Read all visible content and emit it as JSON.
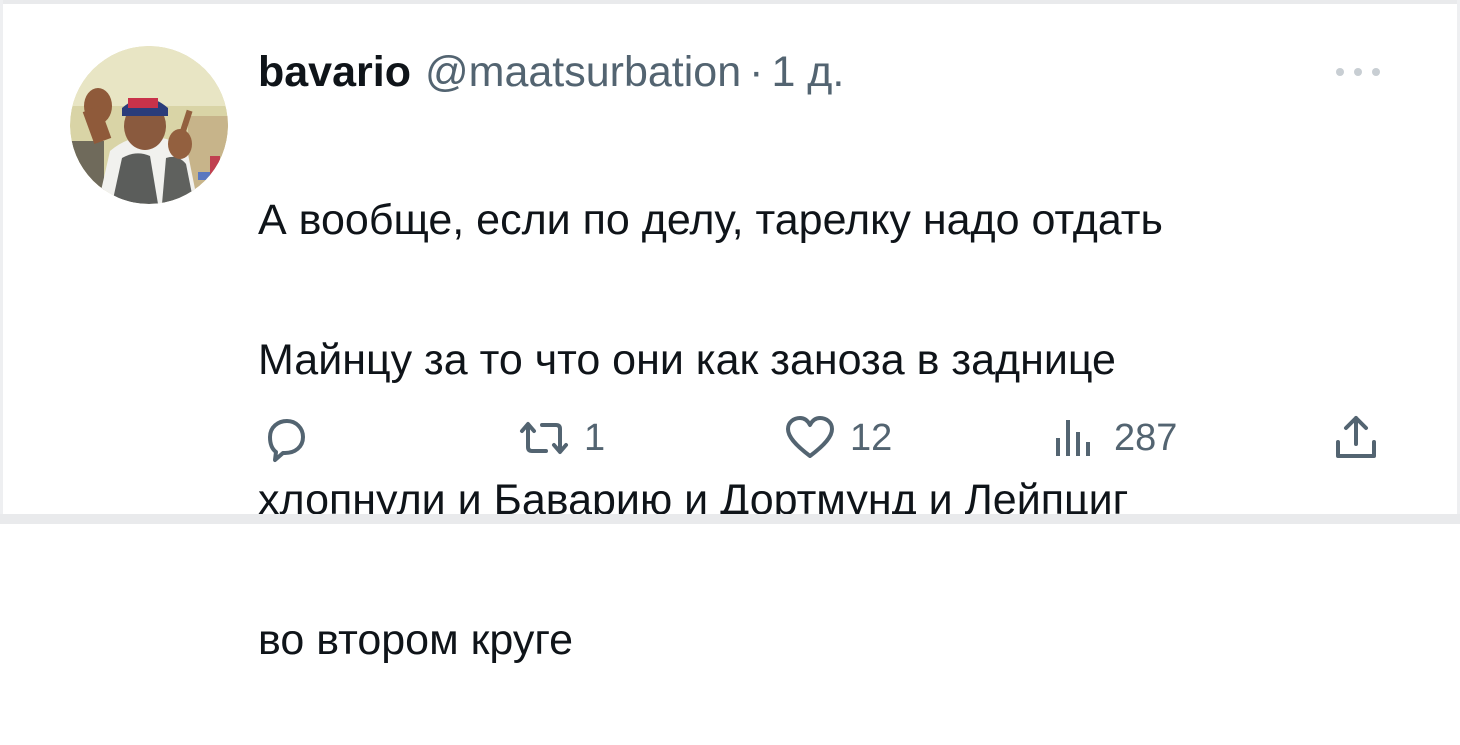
{
  "tweet": {
    "author": {
      "display_name": "bavario",
      "handle": "@maatsurbation"
    },
    "separator": "·",
    "timestamp": "1 д.",
    "text_lines": [
      "А вообще, если по делу, тарелку надо отдать",
      "Майнцу за то что они как заноза в заднице",
      "хлопнули и Баварию и Дортмунд и Лейпциг",
      "во втором круге"
    ],
    "actions": {
      "reply": {
        "icon": "reply-icon",
        "count": ""
      },
      "retweet": {
        "icon": "retweet-icon",
        "count": "1"
      },
      "like": {
        "icon": "heart-icon",
        "count": "12"
      },
      "views": {
        "icon": "views-icon",
        "count": "287"
      },
      "share": {
        "icon": "share-icon",
        "count": ""
      }
    },
    "more_icon": "more-icon"
  },
  "colors": {
    "text_primary": "#0f1419",
    "text_secondary": "#536471",
    "background": "#ffffff"
  }
}
